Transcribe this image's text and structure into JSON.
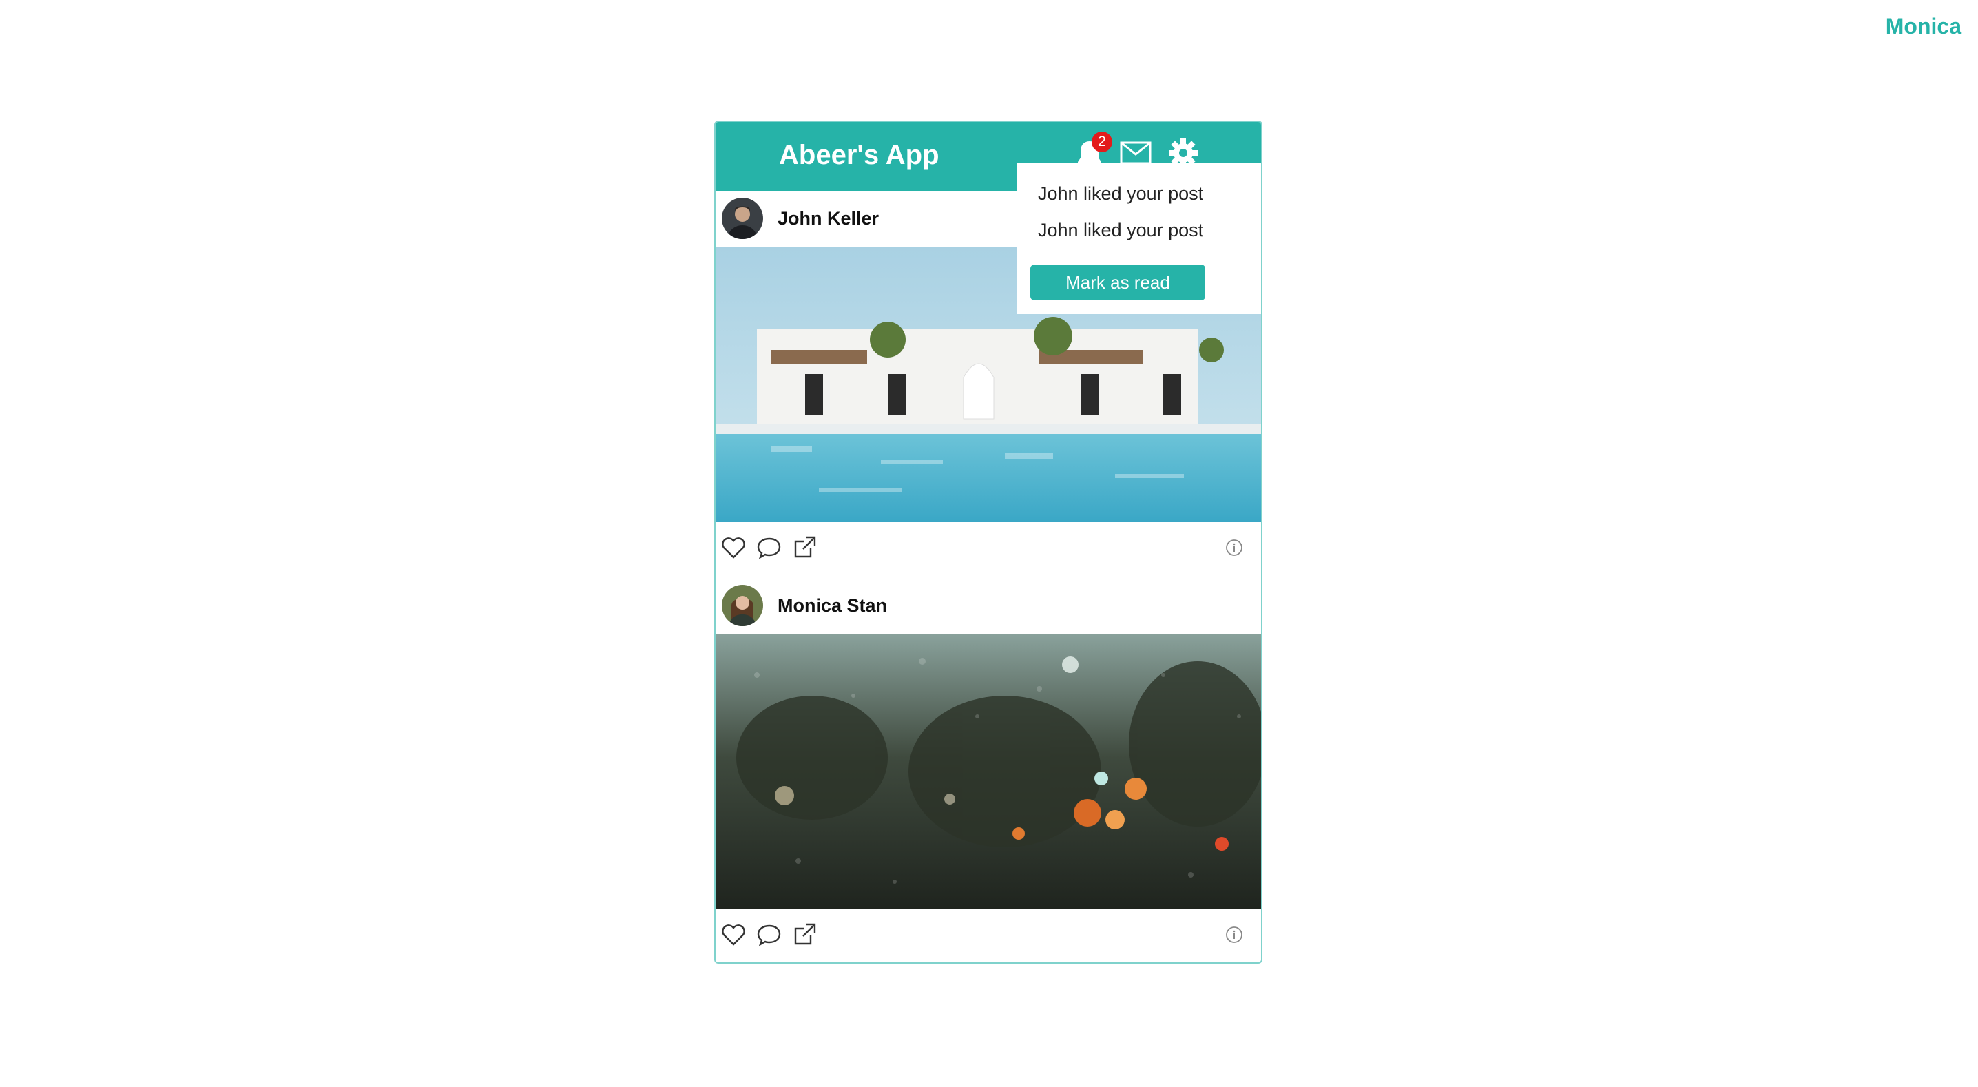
{
  "user": {
    "name": "Monica"
  },
  "header": {
    "title": "Abeer's App",
    "notification_count": "2",
    "icons": [
      "bell-icon",
      "mail-icon",
      "gear-icon"
    ]
  },
  "notifications": {
    "items": [
      {
        "text": "John liked your post"
      },
      {
        "text": "John liked your post"
      }
    ],
    "mark_read_label": "Mark as read"
  },
  "posts": [
    {
      "author": "John Keller",
      "image": "white villa with palm trees beside a pool"
    },
    {
      "author": "Monica Stan",
      "image": "rainy window with blurred city lights"
    }
  ],
  "colors": {
    "accent": "#26b3a8",
    "badge": "#e31b1b",
    "border": "#7fd2cc"
  }
}
